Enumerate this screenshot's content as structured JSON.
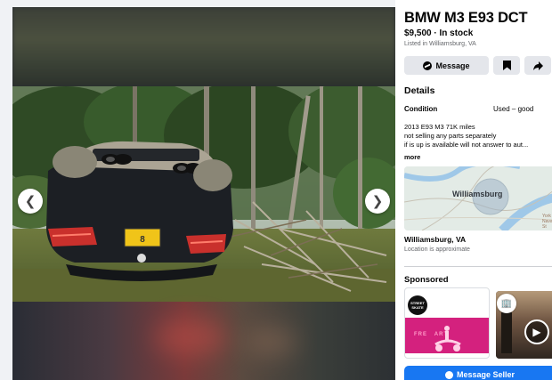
{
  "listing": {
    "title": "BMW M3 E93 DCT",
    "price_status": "$9,500 · In stock",
    "listed_in": "Listed in Williamsburg, VA"
  },
  "actions": {
    "message_label": "Message",
    "save_icon": "bookmark-icon",
    "share_icon": "share-icon"
  },
  "details": {
    "heading": "Details",
    "condition_label": "Condition",
    "condition_value": "Used – good",
    "description_lines": [
      "2013 E93 M3 71K miles",
      "not selling any parts separately",
      "if is up is available will not answer to aut..."
    ],
    "more_label": "more"
  },
  "map": {
    "city_label": "Williamsburg",
    "corner_label": "York\nNaval Wea\nSt"
  },
  "location": {
    "title": "Williamsburg, VA",
    "subtitle": "Location is approximate"
  },
  "sponsored": {
    "heading": "Sponsored",
    "ad1_logo_text": "STREET\nSKATE",
    "ad1_banner_text": "FRE   ART"
  },
  "cta": {
    "label": "Message Seller"
  },
  "viewer": {
    "prev_icon": "chevron-left-icon",
    "next_icon": "chevron-right-icon",
    "license_plate": "8"
  },
  "colors": {
    "accent": "#1877f2",
    "button_bg": "#e4e6eb",
    "muted_text": "#65676b",
    "page_bg": "#f0f2f5"
  }
}
